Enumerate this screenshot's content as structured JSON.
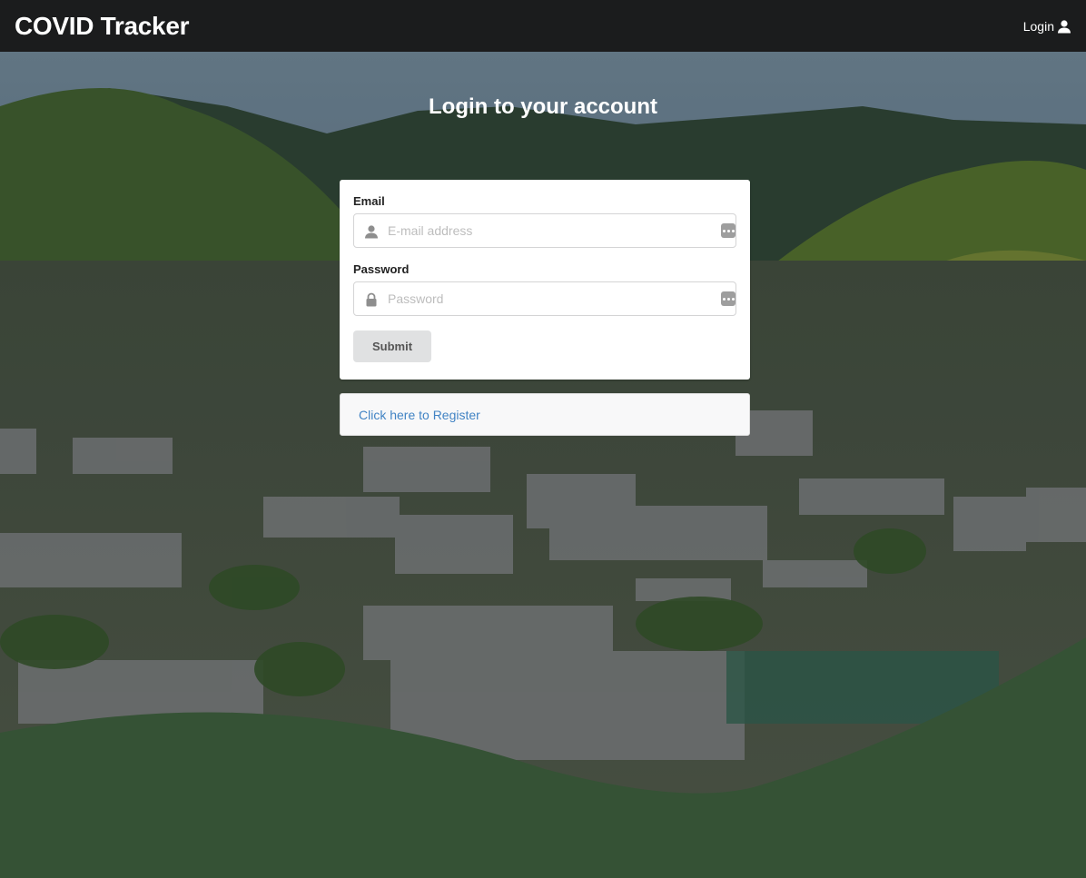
{
  "navbar": {
    "brand": "COVID Tracker",
    "login_label": "Login"
  },
  "page": {
    "title": "Login to your account"
  },
  "form": {
    "email": {
      "label": "Email",
      "placeholder": "E-mail address",
      "value": ""
    },
    "password": {
      "label": "Password",
      "placeholder": "Password",
      "value": ""
    },
    "submit_label": "Submit"
  },
  "register": {
    "link_text": "Click here to Register"
  },
  "icons": {
    "nav_login": "user-icon",
    "email_lead": "user-icon",
    "password_lead": "lock-icon",
    "field_trail": "password-manager-icon"
  },
  "colors": {
    "navbar_bg": "#1b1c1d",
    "wave_green": "#3a5a3a",
    "link": "#4183c4",
    "button_bg": "#e0e1e2"
  }
}
